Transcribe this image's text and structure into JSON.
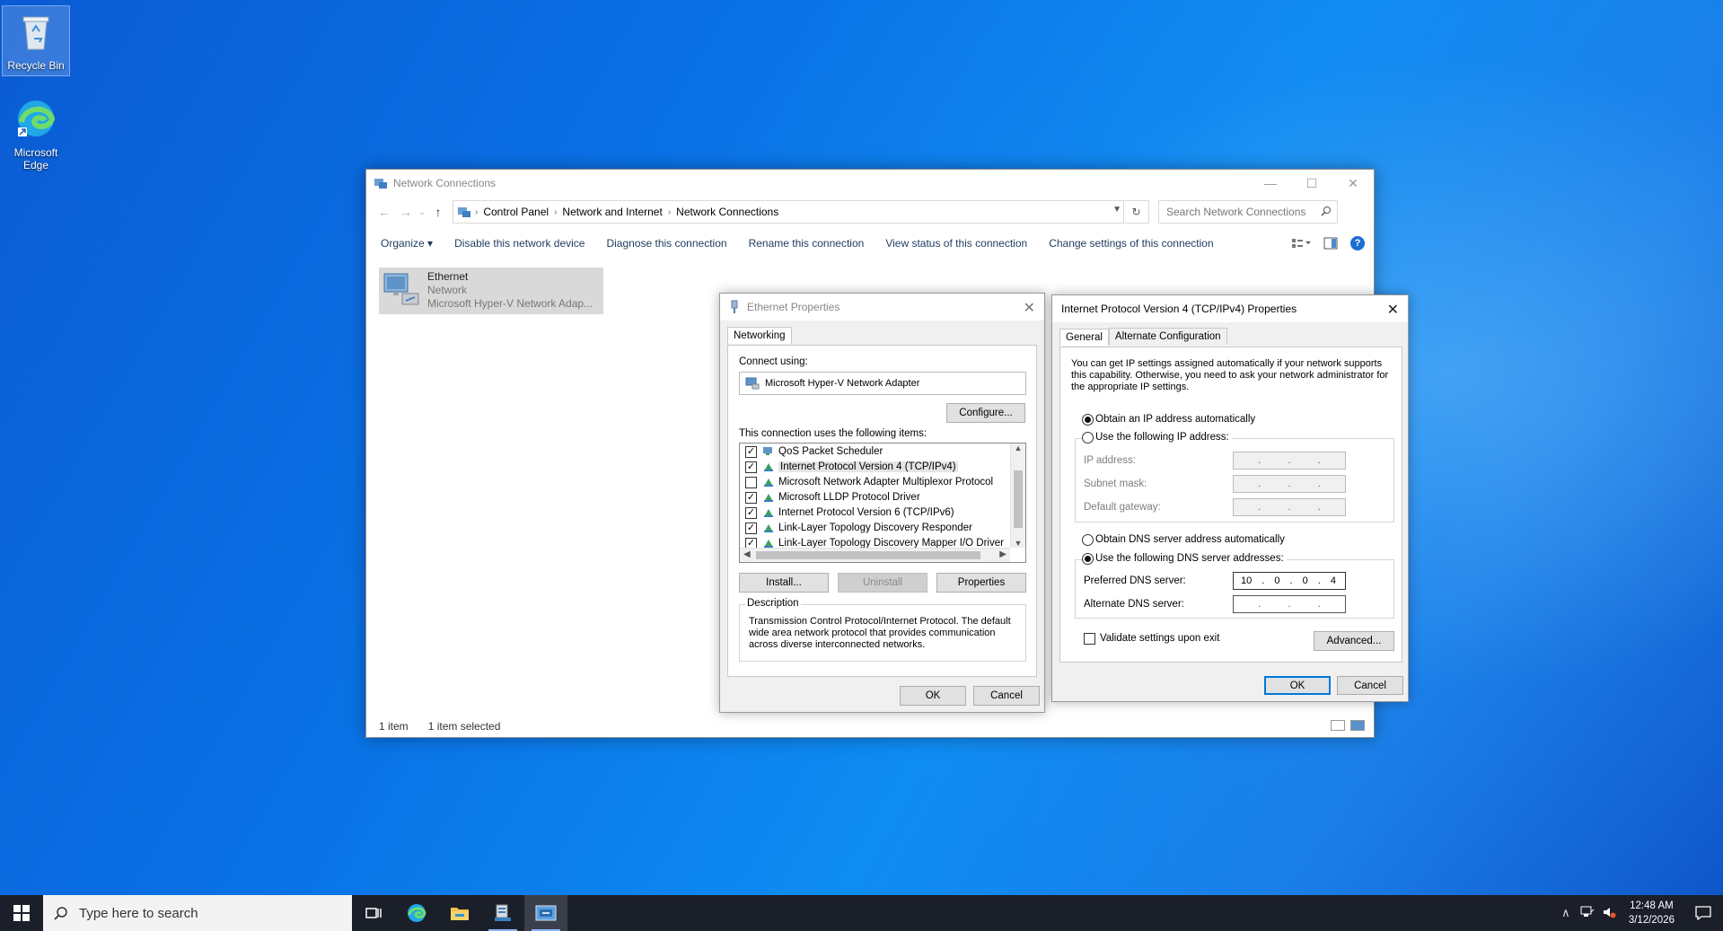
{
  "desktop": {
    "icons": [
      {
        "label": "Recycle Bin"
      },
      {
        "label": "Microsoft Edge"
      }
    ]
  },
  "explorer": {
    "title": "Network Connections",
    "breadcrumb": [
      "Control Panel",
      "Network and Internet",
      "Network Connections"
    ],
    "search_placeholder": "Search Network Connections",
    "commands": [
      "Organize ▾",
      "Disable this network device",
      "Diagnose this connection",
      "Rename this connection",
      "View status of this connection",
      "Change settings of this connection"
    ],
    "item": {
      "name": "Ethernet",
      "status": "Network",
      "adapter": "Microsoft Hyper-V Network Adap..."
    },
    "status": {
      "count": "1 item",
      "selected": "1 item selected"
    }
  },
  "eth_props": {
    "title": "Ethernet Properties",
    "tab": "Networking",
    "connect_using_label": "Connect using:",
    "adapter": "Microsoft Hyper-V Network Adapter",
    "configure": "Configure...",
    "items_label": "This connection uses the following items:",
    "items": [
      {
        "label": "QoS Packet Scheduler",
        "checked": true
      },
      {
        "label": "Internet Protocol Version 4 (TCP/IPv4)",
        "checked": true
      },
      {
        "label": "Microsoft Network Adapter Multiplexor Protocol",
        "checked": false
      },
      {
        "label": "Microsoft LLDP Protocol Driver",
        "checked": true
      },
      {
        "label": "Internet Protocol Version 6 (TCP/IPv6)",
        "checked": true
      },
      {
        "label": "Link-Layer Topology Discovery Responder",
        "checked": true
      },
      {
        "label": "Link-Layer Topology Discovery Mapper I/O Driver",
        "checked": true
      }
    ],
    "install": "Install...",
    "uninstall": "Uninstall",
    "properties": "Properties",
    "description_label": "Description",
    "description": "Transmission Control Protocol/Internet Protocol. The default wide area network protocol that provides communication across diverse interconnected networks.",
    "ok": "OK",
    "cancel": "Cancel"
  },
  "ipv4": {
    "title": "Internet Protocol Version 4 (TCP/IPv4) Properties",
    "tabs": [
      "General",
      "Alternate Configuration"
    ],
    "intro": "You can get IP settings assigned automatically if your network supports this capability. Otherwise, you need to ask your network administrator for the appropriate IP settings.",
    "obtain_ip": "Obtain an IP address automatically",
    "use_ip": "Use the following IP address:",
    "ip_address": "IP address:",
    "subnet": "Subnet mask:",
    "gateway": "Default gateway:",
    "obtain_dns": "Obtain DNS server address automatically",
    "use_dns": "Use the following DNS server addresses:",
    "preferred_dns": "Preferred DNS server:",
    "preferred_dns_value": [
      "10",
      "0",
      "0",
      "4"
    ],
    "alternate_dns": "Alternate DNS server:",
    "validate": "Validate settings upon exit",
    "advanced": "Advanced...",
    "ok": "OK",
    "cancel": "Cancel"
  },
  "taskbar": {
    "search_placeholder": "Type here to search",
    "time": "12:48 AM",
    "date": "3/12/2026"
  }
}
